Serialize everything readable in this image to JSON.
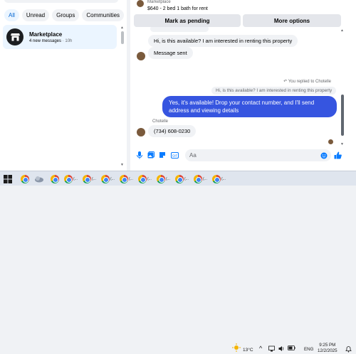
{
  "filters": [
    {
      "label": "All",
      "active": true
    },
    {
      "label": "Unread",
      "active": false
    },
    {
      "label": "Groups",
      "active": false
    },
    {
      "label": "Communities",
      "active": false
    }
  ],
  "chat_list": {
    "item": {
      "title": "Marketplace",
      "subtitle": "4 new messages",
      "time": "· 10h"
    }
  },
  "header": {
    "source": "Marketplace",
    "title": "$640 - 2 bed 1 bath for rent",
    "btn_pending": "Mark as pending",
    "btn_more": "More options"
  },
  "messages": {
    "in1": "Hi, is this available? I am interested in renting this property",
    "in2": "Message sent",
    "replied_label": "You replied to Chotelle",
    "quoted": "Hi, is this available? I am interested in renting this property",
    "out1": "Yes, it's available! Drop your contact number, and I'll send address and viewing details",
    "sender": "Chotelle",
    "in3": "(734) 608-0230"
  },
  "composer": {
    "placeholder": "Aa"
  },
  "taskbar": {
    "apps": [
      "",
      "",
      "",
      "(...",
      "(...",
      "(...",
      "(...",
      "(...",
      "(...",
      "(...",
      "(...",
      "(...",
      "(..."
    ],
    "weather": "13°C",
    "language": "ENG",
    "time": "9:25 PM",
    "date": "12/2/2025"
  },
  "colors": {
    "accent": "#3655e0",
    "active_chip": "#0064d1",
    "like": "#0a7cff"
  }
}
